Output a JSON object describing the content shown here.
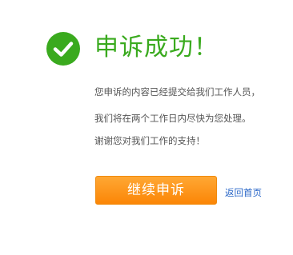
{
  "status": {
    "icon": "check-circle-icon",
    "icon_color": "#3aaa1e",
    "title": "申诉成功！",
    "title_color": "#3aaa1e"
  },
  "messages": [
    "您申诉的内容已经提交给我们工作人员，",
    "我们将在两个工作日内尽快为您处理。",
    "谢谢您对我们工作的支持！"
  ],
  "actions": {
    "continue_label": "继续申诉",
    "continue_color": "#fb8606",
    "home_link_label": "返回首页",
    "home_link_color": "#2a67c8"
  }
}
